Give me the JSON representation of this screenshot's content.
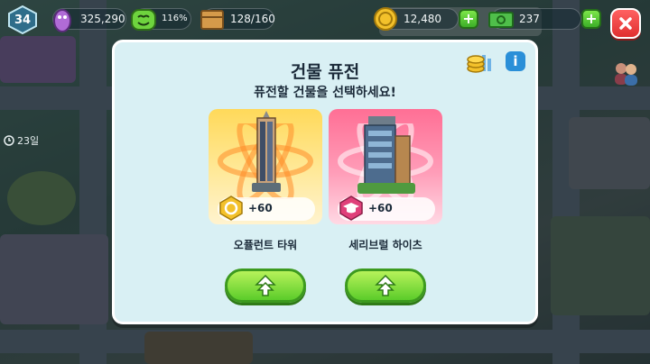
{
  "hud": {
    "level": "34",
    "population": "325,290",
    "happiness": "116%",
    "storage": "128/160",
    "coins": "12,480",
    "cash": "237",
    "days": "23일"
  },
  "dialog": {
    "title": "건물 퓨전",
    "subtitle": "퓨전할 건물을 선택하세요!",
    "buildings": [
      {
        "name": "오퓰런트 타워",
        "reward": "+60",
        "reward_icon": "gold-coin-icon",
        "theme": "#ffd95a"
      },
      {
        "name": "세리브럴 하이츠",
        "reward": "+60",
        "reward_icon": "graduation-cap-icon",
        "theme": "#ff6f95"
      }
    ]
  },
  "colors": {
    "accent_green": "#5bcc2a",
    "close_red": "#e02f2f",
    "dialog_bg": "#d9f0f4"
  }
}
